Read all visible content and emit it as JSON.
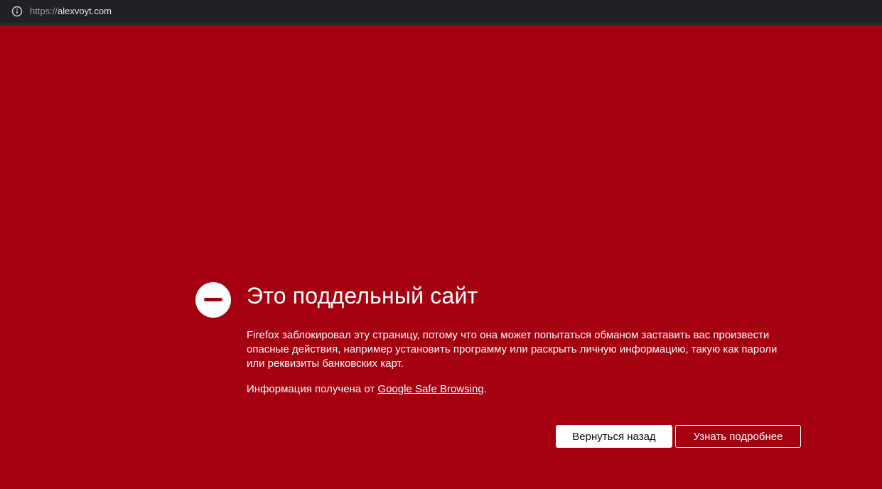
{
  "browser": {
    "url_scheme": "https://",
    "url_host": "alexvoyt.com",
    "info_icon": "info-icon"
  },
  "warning": {
    "icon": "stop-icon",
    "title": "Это поддельный сайт",
    "description": "Firefox заблокировал эту страницу, потому что она может попытаться обманом заставить вас произвести опасные действия, например установить программу или раскрыть личную информацию, такую как пароли или реквизиты банковских карт.",
    "source_prefix": "Информация получена от ",
    "source_link": "Google Safe Browsing",
    "source_suffix": ".",
    "back_button": "Вернуться назад",
    "more_button": "Узнать подробнее"
  },
  "colors": {
    "background": "#a50010",
    "toolbar": "#202124"
  }
}
